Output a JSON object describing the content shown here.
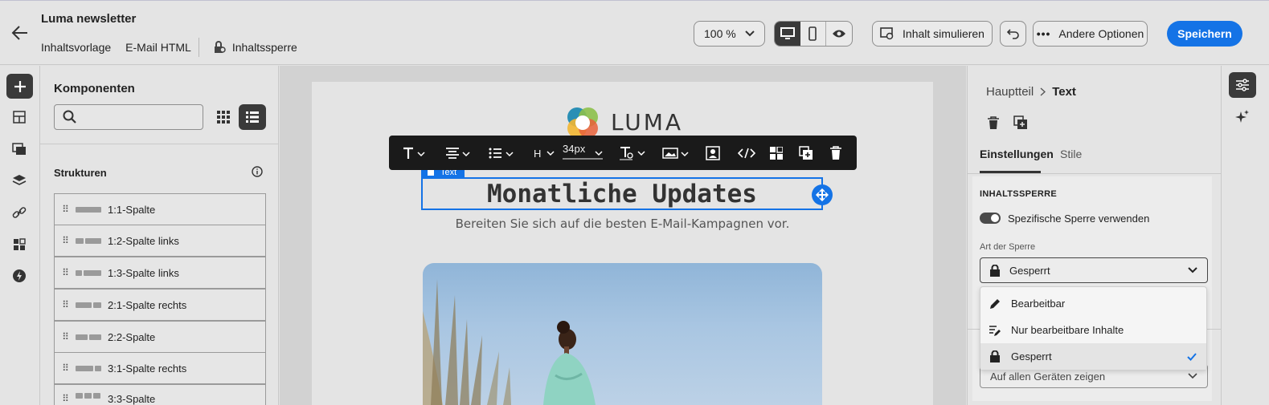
{
  "header": {
    "title": "Luma newsletter",
    "breadcrumb": [
      "Inhaltsvorlage",
      "E-Mail HTML"
    ],
    "lock_label": "Inhaltssperre",
    "zoom": "100 %",
    "simulate_label": "Inhalt simulieren",
    "more_options_label": "Andere Optionen",
    "save_label": "Speichern",
    "accent": "#1473e6"
  },
  "components": {
    "title": "Komponenten",
    "search_placeholder": "",
    "structures_title": "Strukturen",
    "structures": [
      "1:1-Spalte",
      "1:2-Spalte links",
      "1:3-Spalte links",
      "2:1-Spalte rechts",
      "2:2-Spalte",
      "3:1-Spalte rechts",
      "3:3-Spalte"
    ]
  },
  "canvas": {
    "logo_text": "LUMA",
    "text_tag": "Text",
    "heading": "Monatliche Updates",
    "subheading": "Bereiten Sie sich auf die besten E-Mail-Kampagnen vor.",
    "toolbar": {
      "heading_label": "H",
      "font_size": "34px"
    }
  },
  "panel": {
    "breadcrumb_parent": "Hauptteil",
    "breadcrumb_current": "Text",
    "tabs": [
      "Einstellungen",
      "Stile"
    ],
    "section_title": "INHALTSSPERRE",
    "toggle_label": "Spezifische Sperre verwenden",
    "toggle_on": true,
    "lock_type_label": "Art der Sperre",
    "lock_type_value": "Gesperrt",
    "options": [
      "Bearbeitbar",
      "Nur bearbeitbare Inhalte",
      "Gesperrt"
    ],
    "selected_option": "Gesperrt",
    "hidden_select_value": "Auf allen Geräten zeigen"
  }
}
